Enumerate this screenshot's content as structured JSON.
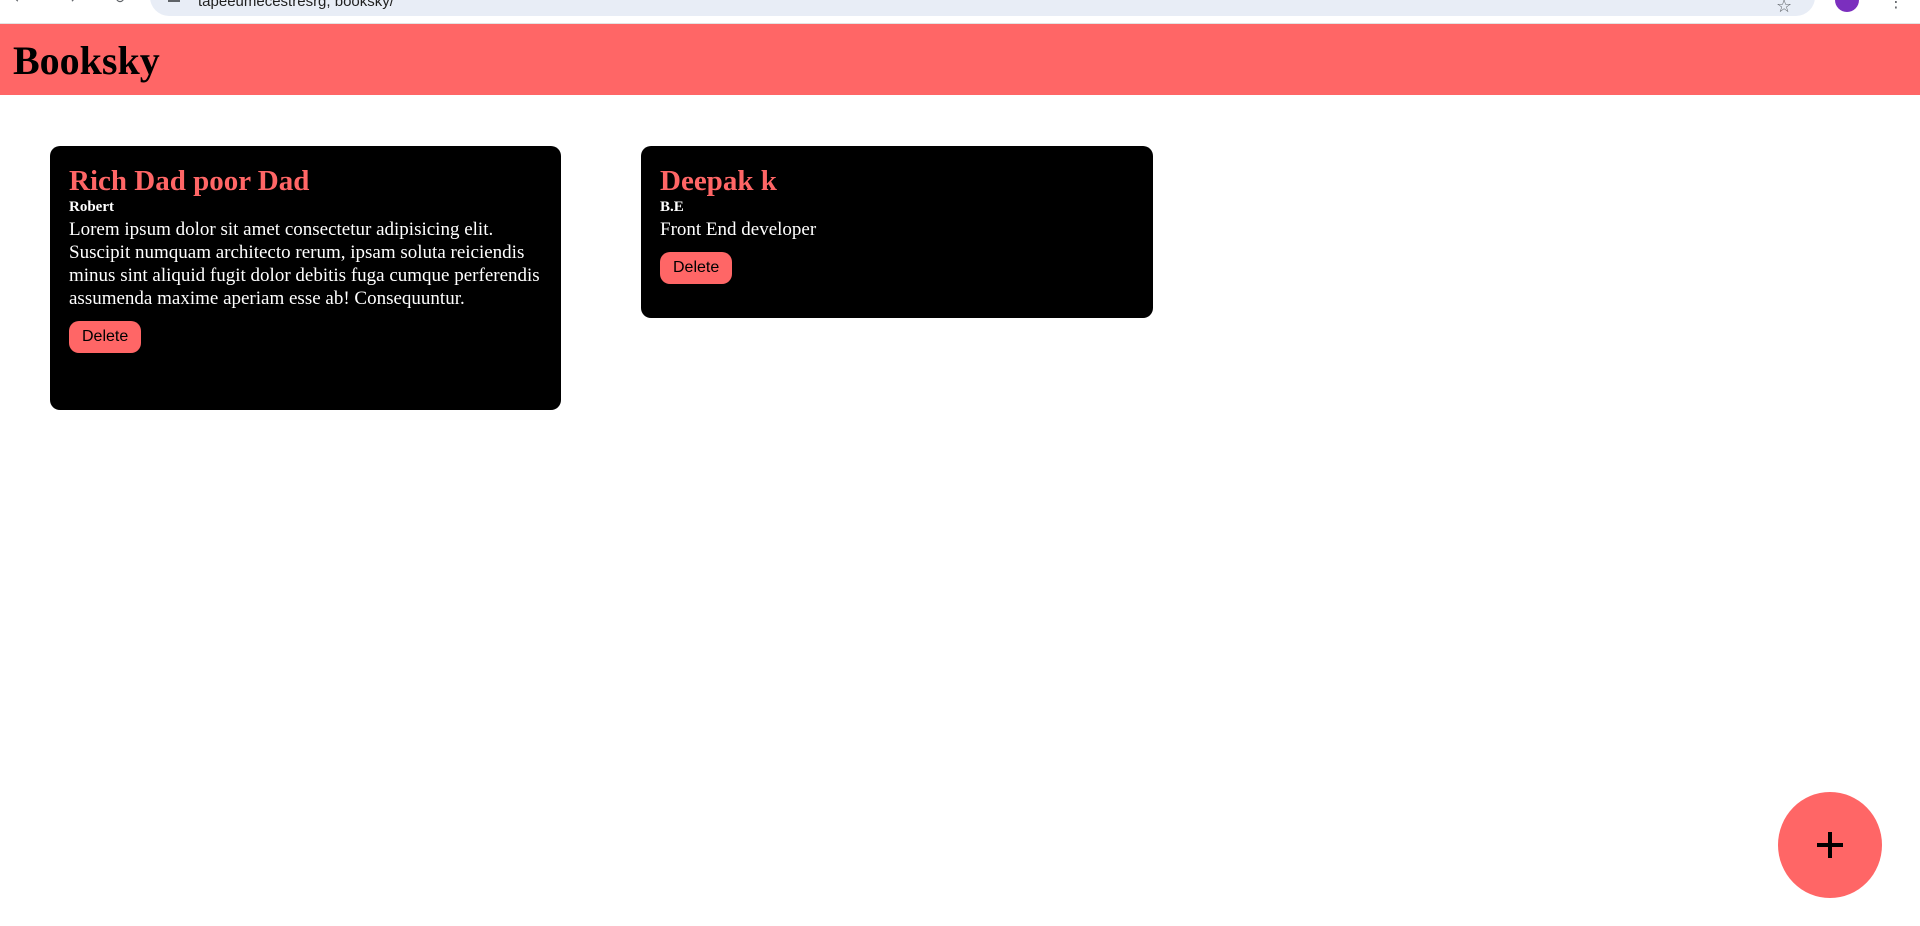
{
  "browser": {
    "url": "tapeeumecestresrg, booksky/",
    "back_icon": "arrow-left-icon",
    "forward_icon": "arrow-right-icon",
    "reload_icon": "reload-icon",
    "star_icon": "star-icon",
    "menu_icon": "kebab-menu-icon",
    "avatar_color": "#7b2fbe"
  },
  "header": {
    "title": "Booksky",
    "background": "#ff6666"
  },
  "books": [
    {
      "title": "Rich Dad poor Dad",
      "author": "Robert",
      "description": "Lorem ipsum dolor sit amet consectetur adipisicing elit. Suscipit numquam architecto rerum, ipsam soluta reiciendis minus sint aliquid fugit dolor debitis fuga cumque perferendis assumenda maxime aperiam esse ab! Consequuntur.",
      "delete_label": "Delete"
    },
    {
      "title": "Deepak k",
      "author": "B.E",
      "description": "Front End developer",
      "delete_label": "Delete"
    }
  ],
  "fab": {
    "icon": "plus-icon",
    "color": "#ff6666"
  },
  "colors": {
    "accent": "#ff6666",
    "card_bg": "#000000",
    "card_text": "#ffffff"
  }
}
